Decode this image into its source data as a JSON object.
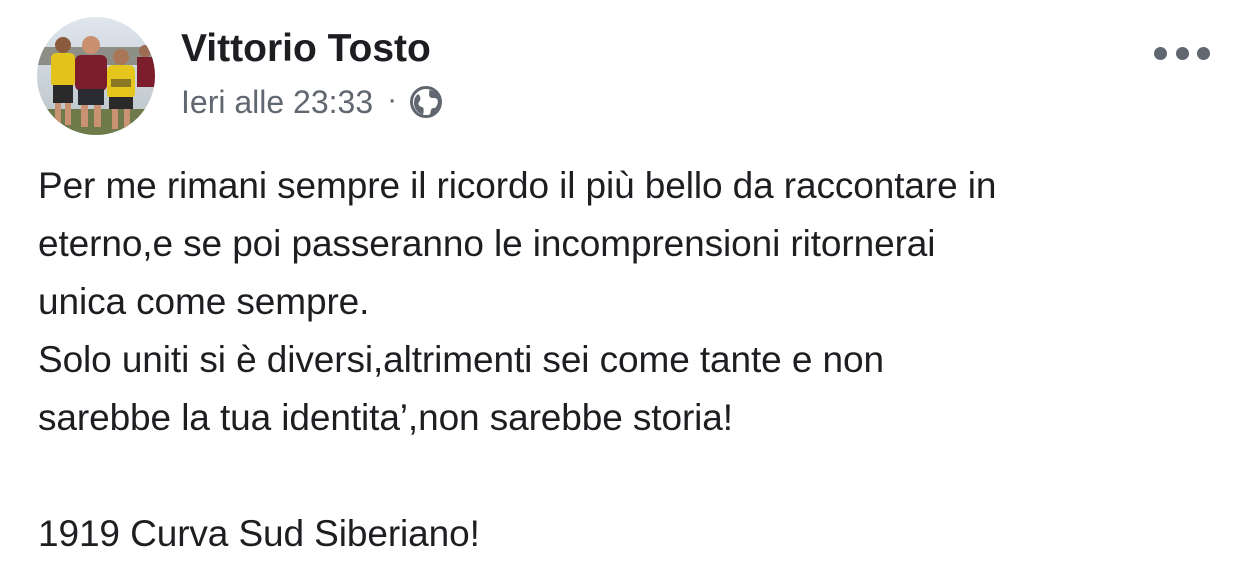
{
  "post": {
    "author": "Vittorio Tosto",
    "timestamp": "Ieri alle 23:33",
    "separator": "·",
    "privacy_icon": "globe-icon",
    "more_icon": "more-options-icon",
    "lines": [
      "Per me rimani sempre il ricordo il più bello da raccontare in",
      "eterno,e se poi passeranno le incomprensioni ritornerai",
      "unica come sempre.",
      "Solo uniti si è diversi,altrimenti sei come tante e non",
      "sarebbe la tua identita’,non sarebbe storia!",
      "",
      "1919 Curva Sud Siberiano!"
    ]
  },
  "colors": {
    "text": "#1c1e21",
    "secondary": "#616770",
    "icon": "#606770"
  }
}
